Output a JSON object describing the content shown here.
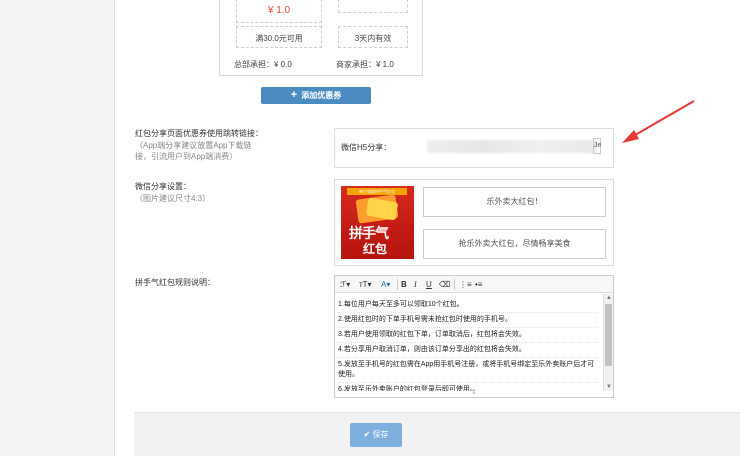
{
  "coupon": {
    "price": "¥ 1.0",
    "condition": "满30.0元可用",
    "validity": "3天内有效",
    "platform_bear": "总部承担：¥ 0.0",
    "merchant_bear": "商家承担：¥ 1.0",
    "add_button": "添加优惠券"
  },
  "redirect_link": {
    "label": "红包分享页面优惠券使用跳转链接：",
    "hint1": "（App端分享建议放置App下载链",
    "hint2": "接，引流用户到App端消费）",
    "field_label": "微信H5分享：",
    "field_end": "Je"
  },
  "wechat_share": {
    "label": "微信分享设置：",
    "hint": "（图片建议尺寸4:3）",
    "image_banner": "每日领取拼手气红包",
    "image_text1": "拼手气",
    "image_text2": "红包",
    "title_value": "乐外卖大红包！",
    "desc_value": "抢乐外卖大红包，尽情畅享美食"
  },
  "rules": {
    "label": "拼手气红包规则说明：",
    "toolbar": {
      "font": "ℱ▾",
      "size": "тT▾",
      "color": "A▾",
      "bold": "B",
      "italic": "I",
      "underline": "U",
      "eraser": "⌫",
      "ol": "⋮≡",
      "ul": "•≡"
    },
    "lines": [
      "1.每位用户每天至多可以领取10个红包。",
      "2.使用红包时的下单手机号需未抢红包时使用的手机号。",
      "3.若用户使用领取的红包下单，订单取消后，红包将会失效。",
      "4.若分享用户取消订单，则由该订单分享出的红包将会失效。",
      "5.发放至手机号的红包需在App用手机号注册，或将手机号绑定至乐外卖账户后才可使用。",
      "6.发放至乐外卖账户的红包登录后即可使用。"
    ]
  },
  "save_button": "保存",
  "colors": {
    "accent": "#4a8bc2",
    "save": "#7fb0dd",
    "price": "#e8453c",
    "arrow": "#e53935"
  }
}
